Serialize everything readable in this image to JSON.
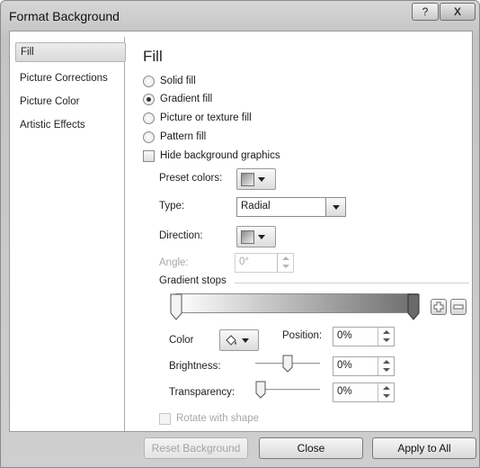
{
  "window": {
    "title": "Format Background",
    "help_glyph": "?",
    "close_glyph": "X"
  },
  "sidebar": {
    "items": [
      {
        "label": "Fill",
        "selected": true
      },
      {
        "label": "Picture Corrections",
        "selected": false
      },
      {
        "label": "Picture Color",
        "selected": false
      },
      {
        "label": "Artistic Effects",
        "selected": false
      }
    ]
  },
  "fill": {
    "title": "Fill",
    "options": [
      {
        "label": "Solid fill",
        "checked": false
      },
      {
        "label": "Gradient fill",
        "checked": true
      },
      {
        "label": "Picture or texture fill",
        "checked": false
      },
      {
        "label": "Pattern fill",
        "checked": false
      }
    ],
    "hide_background_graphics": {
      "label": "Hide background graphics",
      "checked": false
    },
    "preset_colors_label": "Preset colors:",
    "type_label": "Type:",
    "type_value": "Radial",
    "direction_label": "Direction:",
    "angle_label": "Angle:",
    "angle_value": "0°",
    "gradient_stops_label": "Gradient stops",
    "color_label": "Color",
    "position_label": "Position:",
    "position_value": "0%",
    "brightness_label": "Brightness:",
    "brightness_value": "0%",
    "brightness_level": 0.5,
    "transparency_label": "Transparency:",
    "transparency_value": "0%",
    "transparency_level": 0.0,
    "rotate_with_shape": {
      "label": "Rotate with shape",
      "checked": false,
      "enabled": false
    }
  },
  "footer": {
    "reset_label": "Reset Background",
    "close_label": "Close",
    "apply_all_label": "Apply to All"
  },
  "colors": {
    "dialog_bg": "#cfcfcf",
    "panel_bg": "#ffffff",
    "disabled_text": "#a8a8a8"
  }
}
